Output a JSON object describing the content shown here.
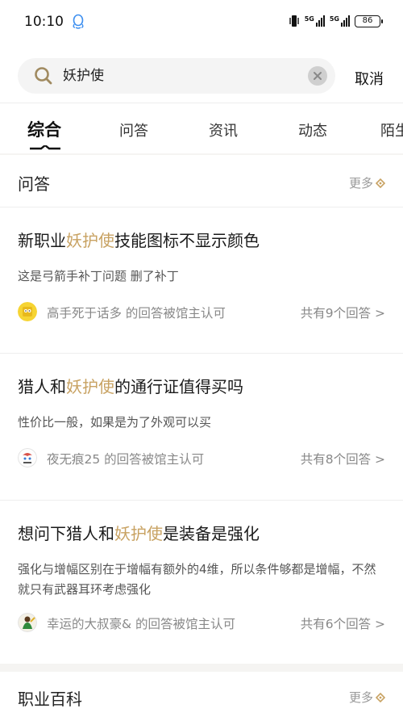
{
  "status_bar": {
    "time": "10:10",
    "network_1": "5G",
    "network_2": "5G",
    "battery": "86"
  },
  "search": {
    "query": "妖护使",
    "cancel_label": "取消"
  },
  "tabs": [
    {
      "label": "综合",
      "active": true
    },
    {
      "label": "问答",
      "active": false
    },
    {
      "label": "资讯",
      "active": false
    },
    {
      "label": "动态",
      "active": false
    },
    {
      "label": "陌生",
      "active": false
    }
  ],
  "qa_section": {
    "title": "问答",
    "more_label": "更多",
    "items": [
      {
        "title_pre": "新职业",
        "highlight": "妖护使",
        "title_post": "技能图标不显示颜色",
        "snippet": "这是弓箭手补丁问题 删了补丁",
        "answerer": "高手死于话多 的回答被馆主认可",
        "count": "共有9个回答 >"
      },
      {
        "title_pre": "猎人和",
        "highlight": "妖护使",
        "title_post": "的通行证值得买吗",
        "snippet": "性价比一般，如果是为了外观可以买",
        "answerer": "夜无痕25 的回答被馆主认可",
        "count": "共有8个回答 >"
      },
      {
        "title_pre": "想问下猎人和",
        "highlight": "妖护使",
        "title_post": "是装备是强化",
        "snippet": "强化与增幅区别在于增幅有额外的4维，所以条件够都是增幅，不然就只有武器耳环考虑强化",
        "answerer": "幸运的大叔豪& 的回答被馆主认可",
        "count": "共有6个回答 >"
      }
    ]
  },
  "wiki_section": {
    "title": "职业百科",
    "more_label": "更多"
  },
  "colors": {
    "highlight": "#c8a262",
    "muted": "#888888"
  }
}
